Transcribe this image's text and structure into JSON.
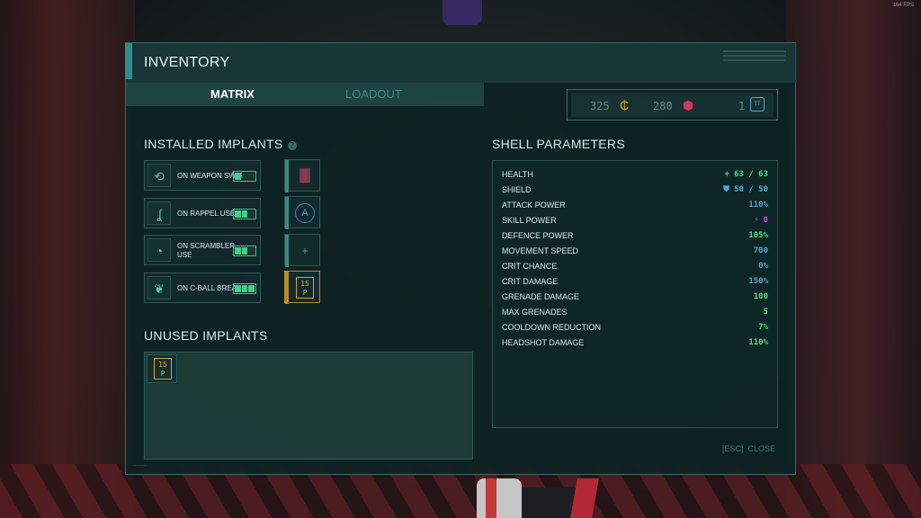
{
  "fps": "164 FPS",
  "inventory": {
    "title": "INVENTORY",
    "tabs": [
      "MATRIX",
      "LOADOUT"
    ],
    "active_tab": "MATRIX"
  },
  "currency": {
    "credits": "325",
    "cubes": "280",
    "tokens": "1",
    "token_icon_label": "TT"
  },
  "installed": {
    "title": "INSTALLED IMPLANTS",
    "help_icon": "?",
    "rows": [
      {
        "label": "ON WEAPON SWAP",
        "battery": 1
      },
      {
        "label": "ON RAPPEL USE",
        "battery": 2
      },
      {
        "label": "ON SCRAMBLER USE",
        "battery": 2
      },
      {
        "label": "ON C-BALL BREAK",
        "battery": 3
      }
    ],
    "slots": [
      {
        "type": "device",
        "text": "",
        "icon": "grenade-device-icon"
      },
      {
        "type": "target",
        "text": "A",
        "icon": "target-A-icon"
      },
      {
        "type": "empty",
        "text": "+",
        "icon": "plus-icon"
      },
      {
        "type": "chip",
        "text_top": "15",
        "text_bottom": "P",
        "icon": "chip-icon"
      }
    ]
  },
  "unused": {
    "title": "UNUSED IMPLANTS",
    "chip_top": "15",
    "chip_bottom": "P"
  },
  "shell": {
    "title": "SHELL PARAMETERS",
    "params": [
      {
        "name": "HEALTH",
        "value": "63 / 63",
        "color": "green",
        "icon": "+"
      },
      {
        "name": "SHIELD",
        "value": "50 / 50",
        "color": "blue",
        "icon": "⛊"
      },
      {
        "name": "ATTACK POWER",
        "value": "110%",
        "color": "blue",
        "icon": ""
      },
      {
        "name": "SKILL POWER",
        "value": "0",
        "color": "pink",
        "icon": "⚡"
      },
      {
        "name": "DEFENCE POWER",
        "value": "105%",
        "color": "green",
        "icon": ""
      },
      {
        "name": "MOVEMENT SPEED",
        "value": "700",
        "color": "blue",
        "icon": ""
      },
      {
        "name": "CRIT CHANCE",
        "value": "0%",
        "color": "blue",
        "icon": ""
      },
      {
        "name": "CRIT DAMAGE",
        "value": "150%",
        "color": "blue",
        "icon": ""
      },
      {
        "name": "GRENADE DAMAGE",
        "value": "100",
        "color": "green",
        "icon": ""
      },
      {
        "name": "MAX GRENADES",
        "value": "5",
        "color": "green",
        "icon": ""
      },
      {
        "name": "COOLDOWN REDUCTION",
        "value": "7%",
        "color": "green",
        "icon": ""
      },
      {
        "name": "HEADSHOT DAMAGE",
        "value": "110%",
        "color": "green",
        "icon": ""
      }
    ]
  },
  "close": {
    "key": "[ESC]",
    "label": "CLOSE"
  },
  "colors": {
    "accent": "#2f8f88",
    "green": "#4fe07a",
    "blue": "#58a7d2",
    "pink": "#c63fdf",
    "gold": "#d9a22e"
  }
}
